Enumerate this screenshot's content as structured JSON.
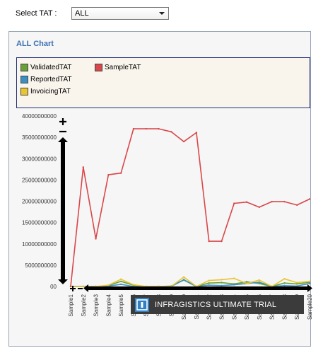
{
  "filter": {
    "label": "Select TAT :",
    "selected": "ALL"
  },
  "chart_panel": {
    "title": "ALL Chart"
  },
  "colors": {
    "validated": "#6aa03a",
    "sample": "#d9474a",
    "reported": "#3a8fc4",
    "invoicing": "#e8c531"
  },
  "watermark": {
    "text": "INFRAGISTICS ULTIMATE    TRIAL"
  },
  "chart_data": {
    "type": "line",
    "title": "",
    "xlabel": "",
    "ylabel": "",
    "ylim": [
      0,
      40000000000
    ],
    "y_ticks": [
      "40000000000",
      "35000000000",
      "30000000000",
      "25000000000",
      "20000000000",
      "15000000000",
      "10000000000",
      "5000000000",
      "00"
    ],
    "categories": [
      "Sample1",
      "Sample2",
      "Sample3",
      "Sample4",
      "Sample5",
      "Sample6",
      "Sample7",
      "Sample8",
      "Sample9",
      "Sample10",
      "Sample11",
      "Sample12",
      "Sample13",
      "Sample14",
      "Sample15",
      "Sample16",
      "Sample17",
      "Sample18",
      "Sample19",
      "Sample20"
    ],
    "legend_placement": "top",
    "series": [
      {
        "name": "ValidatedTAT",
        "color": "#6aa03a",
        "values": [
          0,
          0,
          0,
          200000000,
          1200000000,
          300000000,
          0,
          0,
          100000000,
          1500000000,
          0,
          800000000,
          900000000,
          600000000,
          1100000000,
          700000000,
          0,
          800000000,
          600000000,
          1000000000
        ]
      },
      {
        "name": "SampleTAT",
        "color": "#d9474a",
        "values": [
          0,
          28000000000,
          11200000000,
          26200000000,
          26600000000,
          37000000000,
          37000000000,
          37000000000,
          36300000000,
          34000000000,
          36100000000,
          10600000000,
          10600000000,
          19500000000,
          19800000000,
          18600000000,
          19900000000,
          19900000000,
          19100000000,
          20500000000
        ]
      },
      {
        "name": "ReportedTAT",
        "color": "#3a8fc4",
        "values": [
          0,
          0,
          0,
          100000000,
          500000000,
          0,
          0,
          0,
          0,
          1600000000,
          0,
          300000000,
          200000000,
          400000000,
          700000000,
          1000000000,
          0,
          200000000,
          100000000,
          700000000
        ]
      },
      {
        "name": "InvoicingTAT",
        "color": "#e8c531",
        "values": [
          0,
          0,
          0,
          300000000,
          1700000000,
          400000000,
          0,
          0,
          0,
          2200000000,
          0,
          1400000000,
          1600000000,
          1900000000,
          700000000,
          1500000000,
          0,
          1800000000,
          900000000,
          1200000000
        ]
      }
    ]
  }
}
